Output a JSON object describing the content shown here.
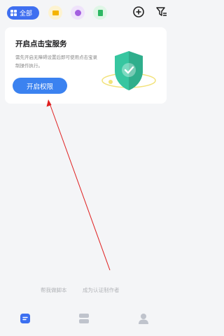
{
  "topbar": {
    "all_chip_label": "全部",
    "categories": [
      {
        "icon": "folder-icon",
        "color": "#f4b400"
      },
      {
        "icon": "cloud-icon",
        "color": "#a45fe0"
      },
      {
        "icon": "book-icon",
        "color": "#2db763"
      }
    ],
    "accent": "#3f6ff0"
  },
  "card": {
    "title": "开启点击宝服务",
    "description": "需先开启无障碍设置后即可使用点击宝录制操作执行。",
    "button_label": "开启权限",
    "button_color": "#3b82f0"
  },
  "footer_links": {
    "help_script": "帮我做脚本",
    "become_author": "成为认证制作者"
  },
  "tabbar": {
    "items": [
      {
        "name": "scripts",
        "icon": "script-list-icon",
        "active": true
      },
      {
        "name": "store",
        "icon": "layers-icon",
        "active": false
      },
      {
        "name": "profile",
        "icon": "user-icon",
        "active": false
      }
    ]
  },
  "annotation": {
    "arrow_color": "#e02020"
  }
}
